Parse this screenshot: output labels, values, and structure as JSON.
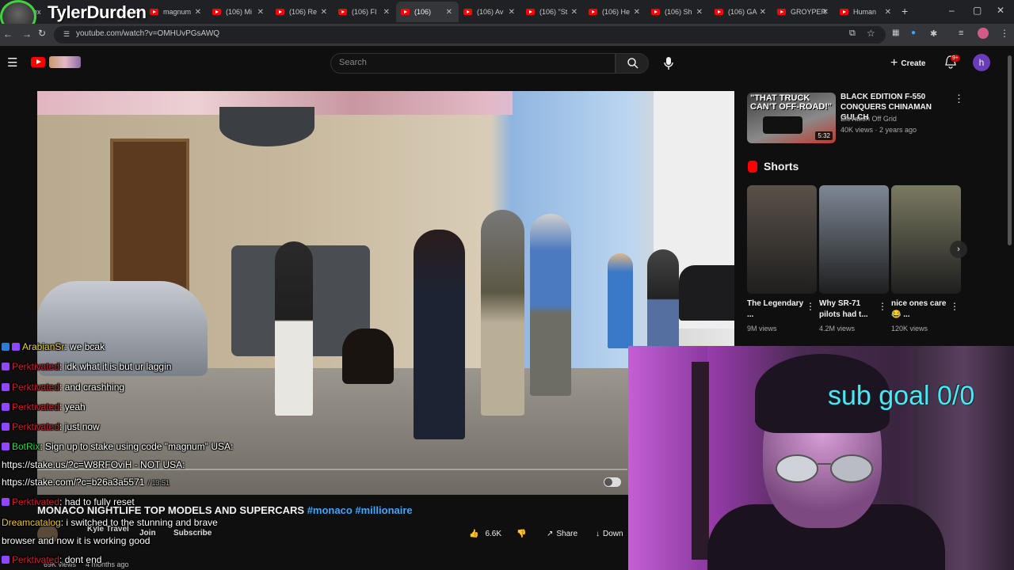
{
  "streamer": {
    "name": "TylerDurden"
  },
  "tabs": [
    {
      "label": "ex"
    },
    {
      "label": "magnum"
    },
    {
      "label": "(106) Mi"
    },
    {
      "label": "(106) Re"
    },
    {
      "label": "(106) FI"
    },
    {
      "label": "(106)",
      "active": true
    },
    {
      "label": "(106) Av"
    },
    {
      "label": "(106) \"St"
    },
    {
      "label": "(106) He"
    },
    {
      "label": "(106) Sh"
    },
    {
      "label": "(106) GA"
    },
    {
      "label": "GROYPER"
    },
    {
      "label": "Human"
    }
  ],
  "address": {
    "url": "youtube.com/watch?v=OMHUvPGsAWQ"
  },
  "youtube": {
    "search_placeholder": "Search",
    "create_label": "Create",
    "notifications": "9+",
    "user_initial": "h"
  },
  "video": {
    "title": "MONACO NIGHTLIFE TOP MODELS AND SUPERCARS",
    "hashtags": [
      "#monaco",
      "#millionaire"
    ],
    "channel": "Kyle Travel",
    "join_label": "Join",
    "subscribe_label": "Subscribe",
    "likes": "6.6K",
    "share_label": "Share",
    "download_label": "Down",
    "views_meta": "69K views",
    "age_meta": "4 months ago"
  },
  "chat": [
    {
      "user": "ArabianSr",
      "color": "#e8d23a",
      "msg": ": we bcak",
      "badges": 2
    },
    {
      "user": "Perktivated",
      "color": "#d11f26",
      "msg": ": idk what it is but ur laggin",
      "badges": 1
    },
    {
      "user": "Perktivated",
      "color": "#d11f26",
      "msg": ": and crashhing",
      "badges": 1
    },
    {
      "user": "Perktivated",
      "color": "#d11f26",
      "msg": ": yeah",
      "badges": 1
    },
    {
      "user": "Perktivated",
      "color": "#d11f26",
      "msg": ": just now",
      "badges": 1
    },
    {
      "user": "BotRix",
      "color": "#2fd34c",
      "msg": ": Sign up to stake using code \"magnum\" USA:",
      "badges": 1
    },
    {
      "user": "",
      "color": "#ffffff",
      "msg": "https://stake.us/?c=W8RFOviH - NOT USA:",
      "badges": 0
    },
    {
      "user": "",
      "color": "#ffffff",
      "msg": "https://stake.com/?c=b26a3a5571",
      "ts": "/ 13:51",
      "badges": 0
    },
    {
      "user": "Perktivated",
      "color": "#d11f26",
      "msg": ": had to fully reset",
      "badges": 1
    },
    {
      "user": "Dreamcatalog",
      "color": "#f3c316",
      "msg": ": i switched to the stunning and brave",
      "badges": 0
    },
    {
      "user": "",
      "color": "#ffffff",
      "msg": "browser and now it is working good",
      "badges": 0
    },
    {
      "user": "Perktivated",
      "color": "#d11f26",
      "msg": ": dont end",
      "badges": 1
    }
  ],
  "recommended": {
    "thumb_text": "\"THAT TRUCK CAN'T OFF-ROAD!\"",
    "duration": "5:32",
    "title": "BLACK EDITION F-550 CONQUERS CHINAMAN GULCH",
    "channel": "Elevation Off Grid",
    "meta": "40K views · 2 years ago"
  },
  "shorts": {
    "heading": "Shorts",
    "items": [
      {
        "title": "The Legendary ...",
        "views": "9M views",
        "color": "#5a5148"
      },
      {
        "title": "Why SR-71 pilots had t...",
        "views": "4.2M views",
        "color": "#7d8794"
      },
      {
        "title": "nice ones care 😂 ...",
        "views": "120K views",
        "color": "#7a7a62"
      }
    ]
  },
  "overlay": {
    "sub_goal": "sub goal 0/0"
  }
}
